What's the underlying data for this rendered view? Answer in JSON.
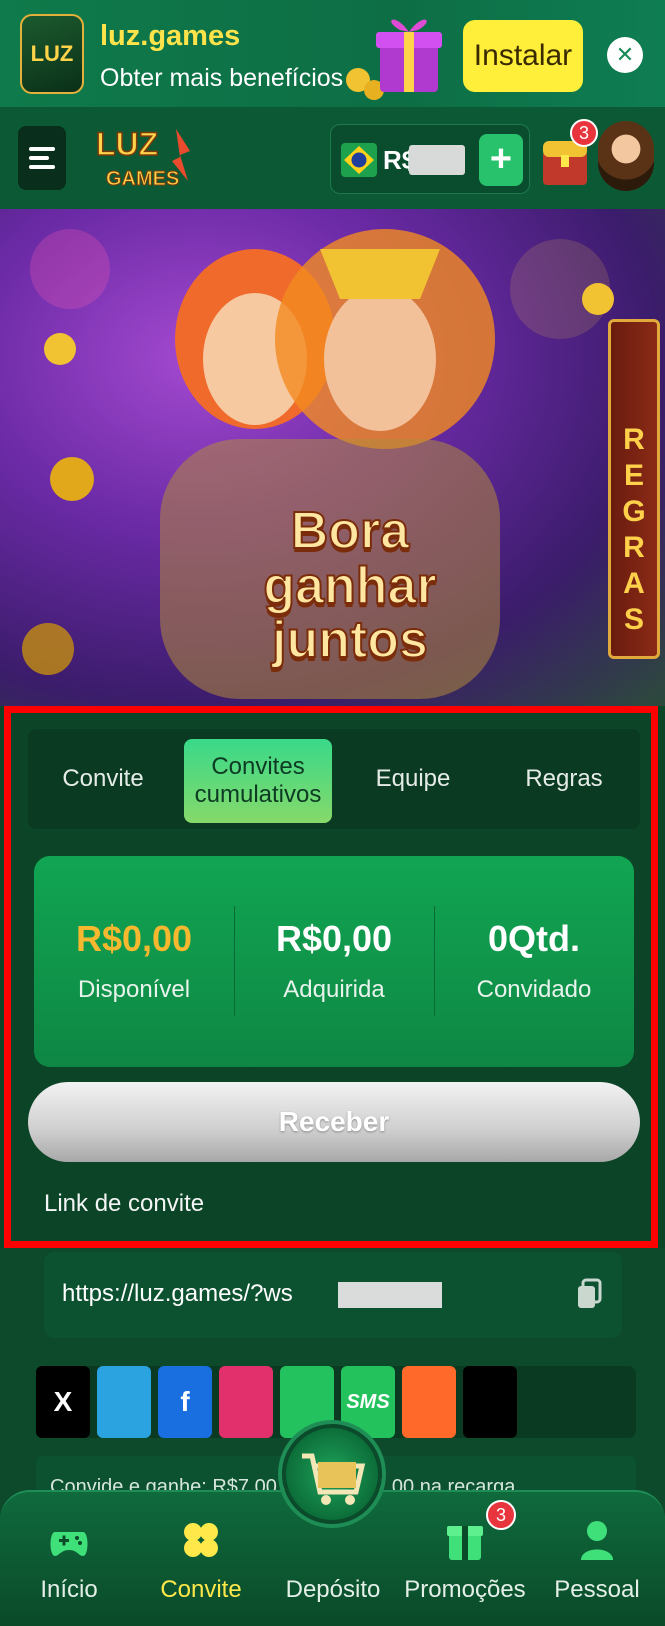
{
  "install_banner": {
    "brand": "luz.games",
    "subtitle": "Obter mais benefícios",
    "install_label": "Instalar",
    "close_symbol": "✕",
    "logo_text": "LUZ"
  },
  "header": {
    "currency": "R$",
    "plus_symbol": "+",
    "chest_badge": "3"
  },
  "hero": {
    "title_line1": "Bora ganhar",
    "title_line2": "juntos",
    "rules_ribbon": "REGRAS"
  },
  "tabs": [
    {
      "label": "Convite"
    },
    {
      "label": "Convites cumulativos"
    },
    {
      "label": "Equipe"
    },
    {
      "label": "Regras"
    }
  ],
  "stats": [
    {
      "value": "R$0,00",
      "label": "Disponível"
    },
    {
      "value": "R$0,00",
      "label": "Adquirida"
    },
    {
      "value": "0Qtd.",
      "label": "Convidado"
    }
  ],
  "receive_label": "Receber",
  "link_label": "Link de convite",
  "invite_link": "https://luz.games/?ws",
  "share": [
    {
      "name": "X",
      "text": "X",
      "color": "#000000"
    },
    {
      "name": "Telegram",
      "text": "",
      "color": "#2aa3e0"
    },
    {
      "name": "Facebook",
      "text": "f",
      "color": "#1a6fe0"
    },
    {
      "name": "Instagram",
      "text": "",
      "color": "#e1306c"
    },
    {
      "name": "WhatsApp",
      "text": "",
      "color": "#24c25e"
    },
    {
      "name": "SMS",
      "text": "SMS",
      "color": "#23c25c"
    },
    {
      "name": "Kwai",
      "text": "",
      "color": "#ff6a2b"
    },
    {
      "name": "TikTok",
      "text": "",
      "color": "#000000"
    }
  ],
  "info_strip": "Convide e ganhe: R$7,00 no ... + R$7,00 na recarga",
  "bottom_nav": [
    {
      "label": "Início"
    },
    {
      "label": "Convite"
    },
    {
      "label": "Depósito"
    },
    {
      "label": "Promoções"
    },
    {
      "label": "Pessoal"
    }
  ],
  "nav_badge": "3",
  "colors": {
    "accent_yellow": "#ffe94a",
    "green_bg": "#0b4427",
    "highlight_frame": "#ff0000",
    "available_amount": "#f5b82e"
  }
}
